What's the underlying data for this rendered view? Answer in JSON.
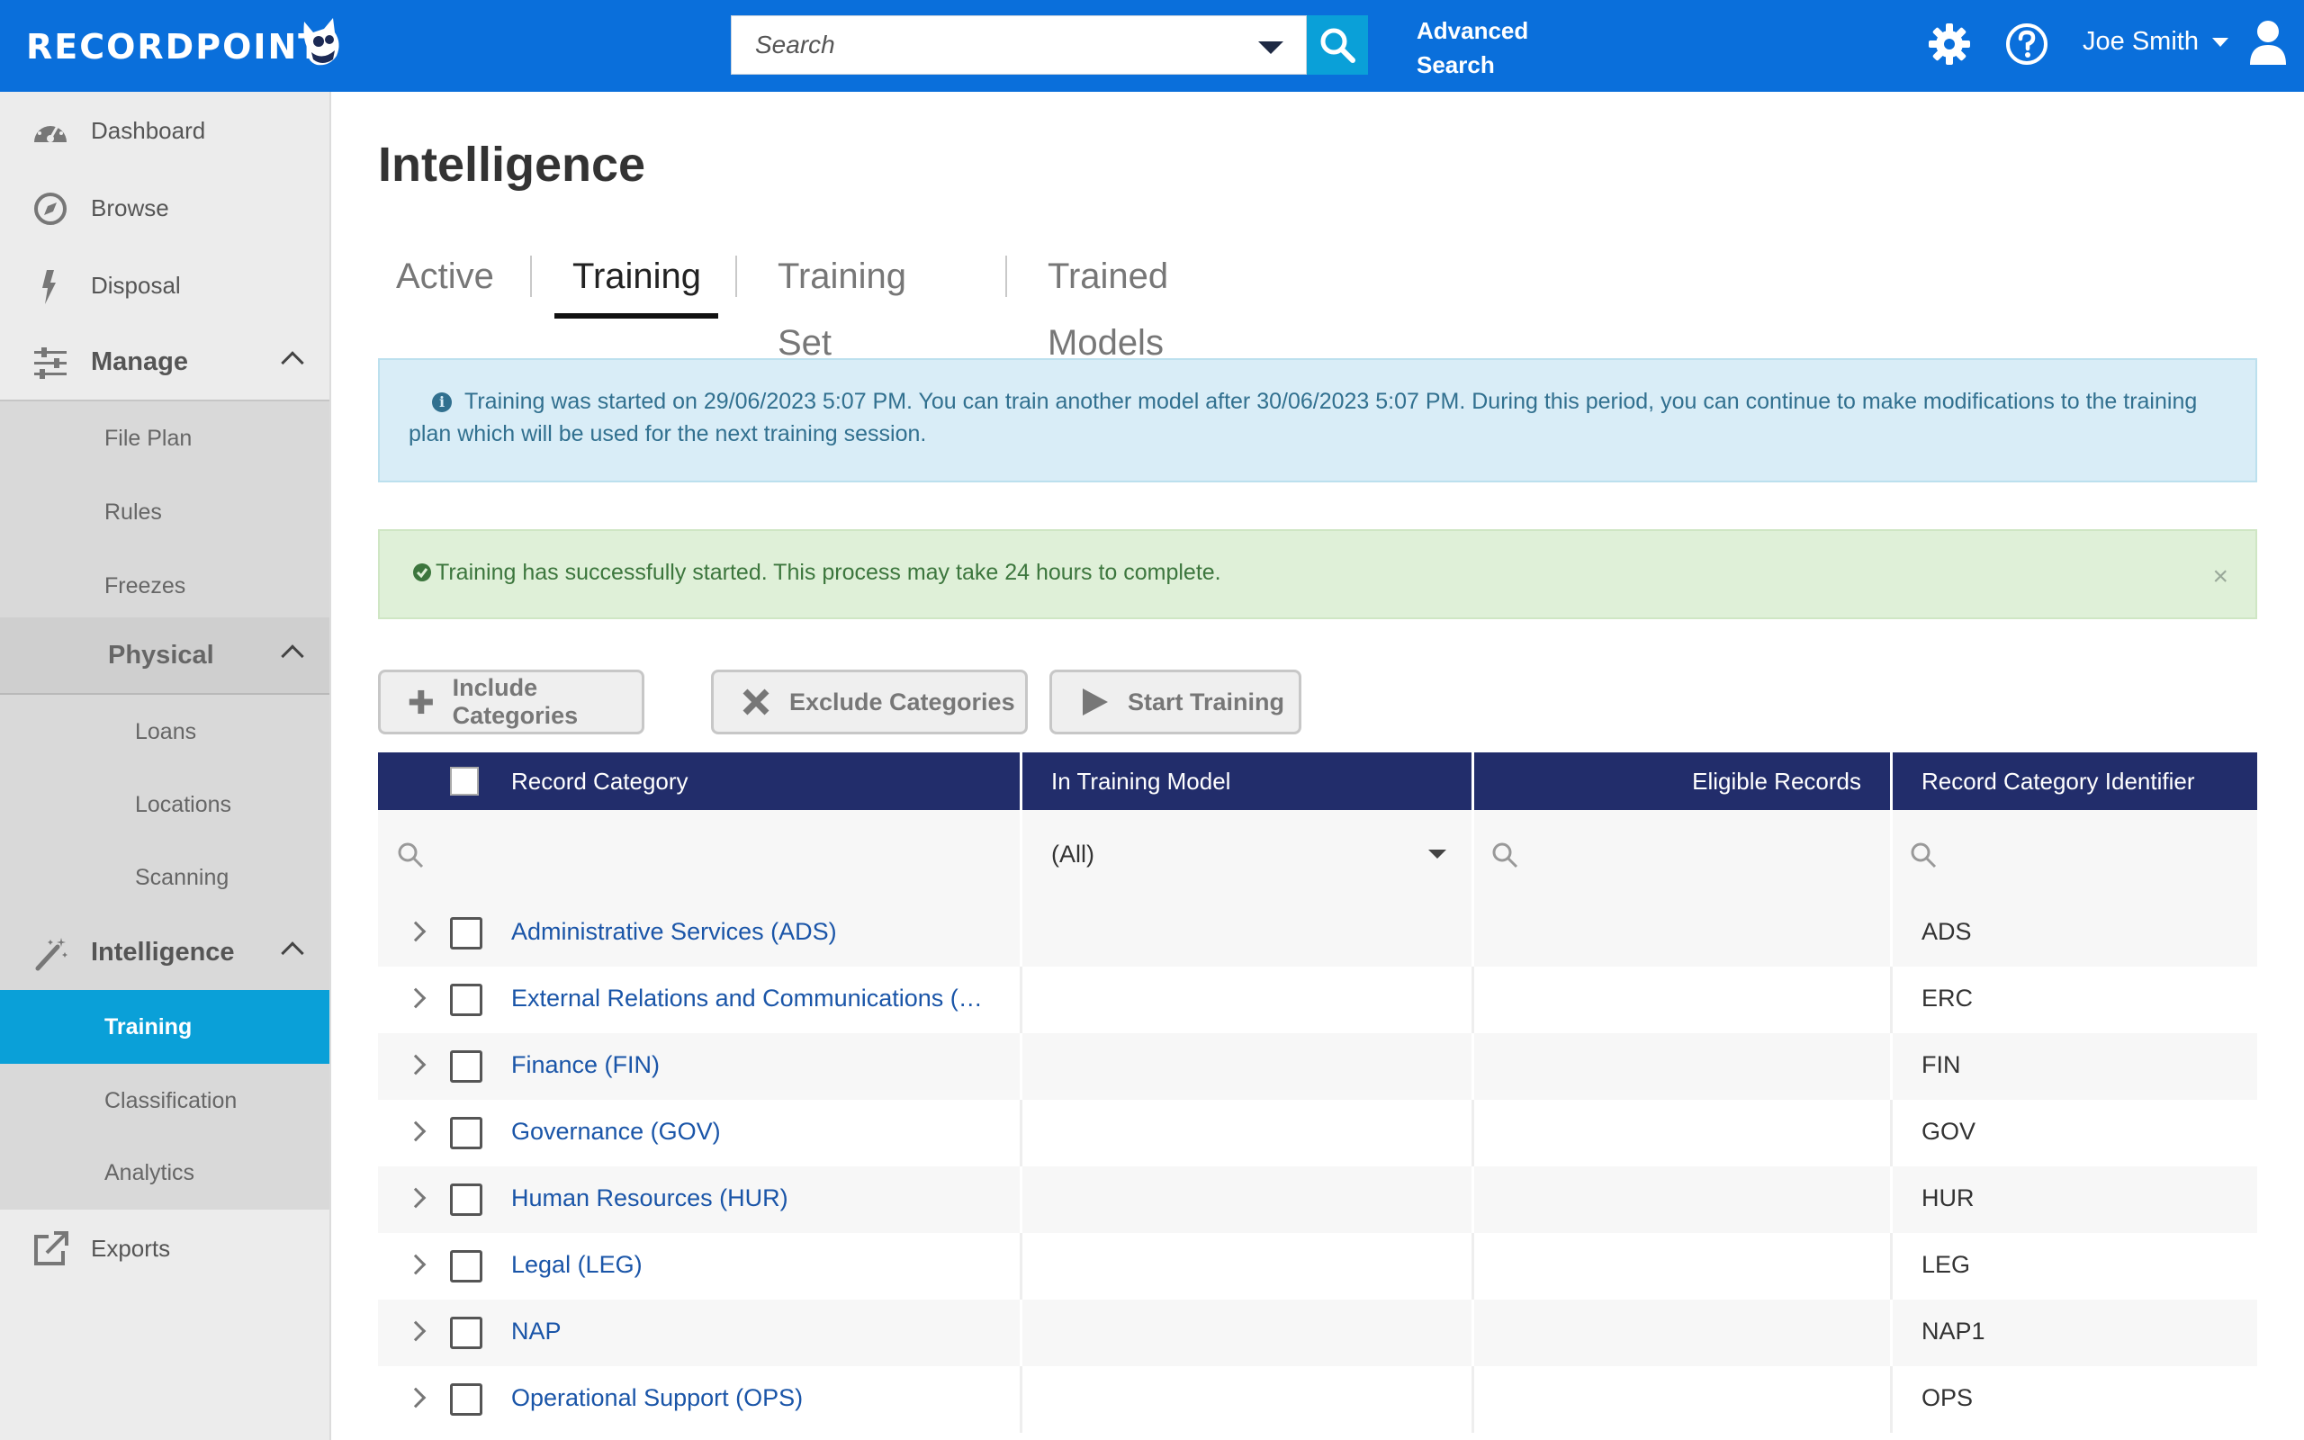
{
  "app": {
    "brand": "RECORDPOINT",
    "search_placeholder": "Search",
    "advanced_search_line1": "Advanced",
    "advanced_search_line2": "Search",
    "user_name": "Joe Smith"
  },
  "colors": {
    "topbar": "#0a6fdb",
    "active_nav": "#0aa0d8",
    "grid_header": "#222d6b",
    "link": "#1a55a8"
  },
  "sidebar": {
    "dashboard": "Dashboard",
    "browse": "Browse",
    "disposal": "Disposal",
    "manage": "Manage",
    "file_plan": "File Plan",
    "rules": "Rules",
    "freezes": "Freezes",
    "physical": "Physical",
    "loans": "Loans",
    "locations": "Locations",
    "scanning": "Scanning",
    "intelligence": "Intelligence",
    "training": "Training",
    "classification": "Classification",
    "analytics": "Analytics",
    "exports": "Exports"
  },
  "page": {
    "title": "Intelligence",
    "tabs": [
      "Active",
      "Training",
      "Training Set",
      "Trained Models"
    ],
    "active_tab": "Training"
  },
  "alerts": {
    "info": "Training was started on 29/06/2023 5:07 PM. You can train another model after 30/06/2023 5:07 PM. During this period, you can continue to make modifications to the training plan which will be used for the next training session.",
    "success": "Training has successfully started. This process may take 24 hours to complete.",
    "close": "×"
  },
  "toolbar": {
    "include": "Include Categories",
    "exclude": "Exclude Categories",
    "start": "Start Training"
  },
  "grid": {
    "columns": [
      "Record Category",
      "In Training Model",
      "Eligible Records",
      "Record Category Identifier"
    ],
    "filter_all": "(All)",
    "rows": [
      {
        "name": "Administrative Services (ADS)",
        "in_model": "",
        "eligible": "",
        "id": "ADS"
      },
      {
        "name": "External Relations and Communications (E…",
        "in_model": "",
        "eligible": "",
        "id": "ERC"
      },
      {
        "name": "Finance (FIN)",
        "in_model": "",
        "eligible": "",
        "id": "FIN"
      },
      {
        "name": "Governance (GOV)",
        "in_model": "",
        "eligible": "",
        "id": "GOV"
      },
      {
        "name": "Human Resources (HUR)",
        "in_model": "",
        "eligible": "",
        "id": "HUR"
      },
      {
        "name": "Legal (LEG)",
        "in_model": "",
        "eligible": "",
        "id": "LEG"
      },
      {
        "name": "NAP",
        "in_model": "",
        "eligible": "",
        "id": "NAP1"
      },
      {
        "name": "Operational Support (OPS)",
        "in_model": "",
        "eligible": "",
        "id": "OPS"
      }
    ]
  }
}
